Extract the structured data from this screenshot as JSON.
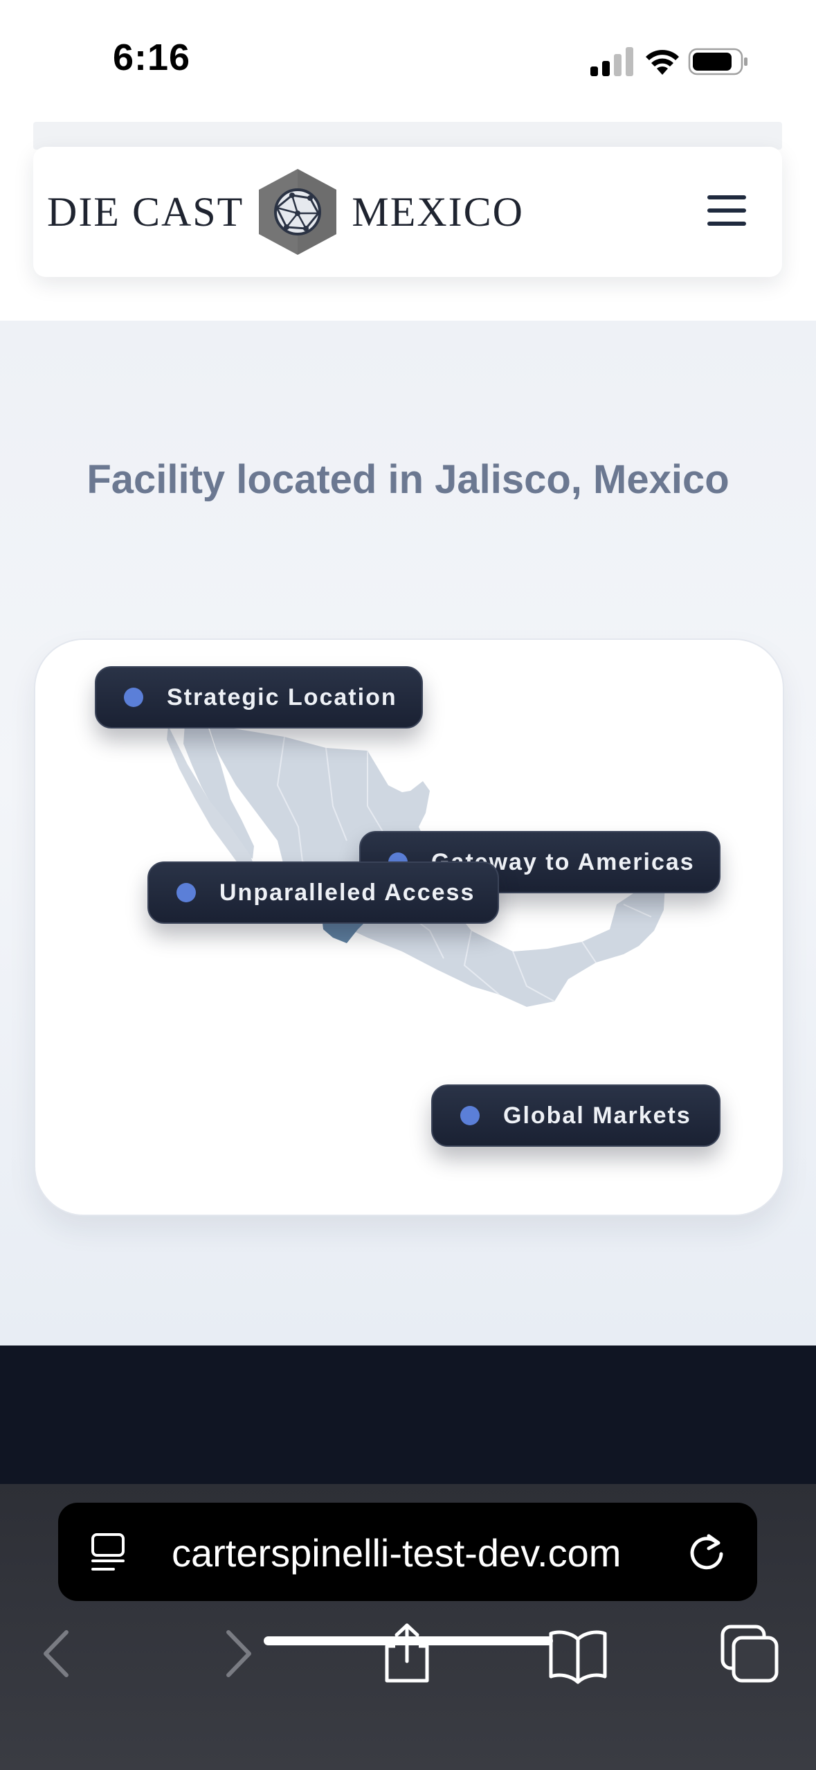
{
  "status_bar": {
    "time": "6:16"
  },
  "header": {
    "logo_left": "DIE CAST",
    "logo_right": "MEXICO"
  },
  "section": {
    "title": "Facility located in Jalisco, Mexico",
    "pills": [
      {
        "label": "Strategic Location"
      },
      {
        "label": "Gateway to Americas"
      },
      {
        "label": "Unparalleled Access"
      },
      {
        "label": "Global Markets"
      }
    ],
    "colors": {
      "accent_dot": "#5b7fd8",
      "map_base": "#cfd7e1",
      "map_highlight": "#5e7f9f"
    }
  },
  "browser": {
    "url": "carterspinelli-test-dev.com"
  }
}
